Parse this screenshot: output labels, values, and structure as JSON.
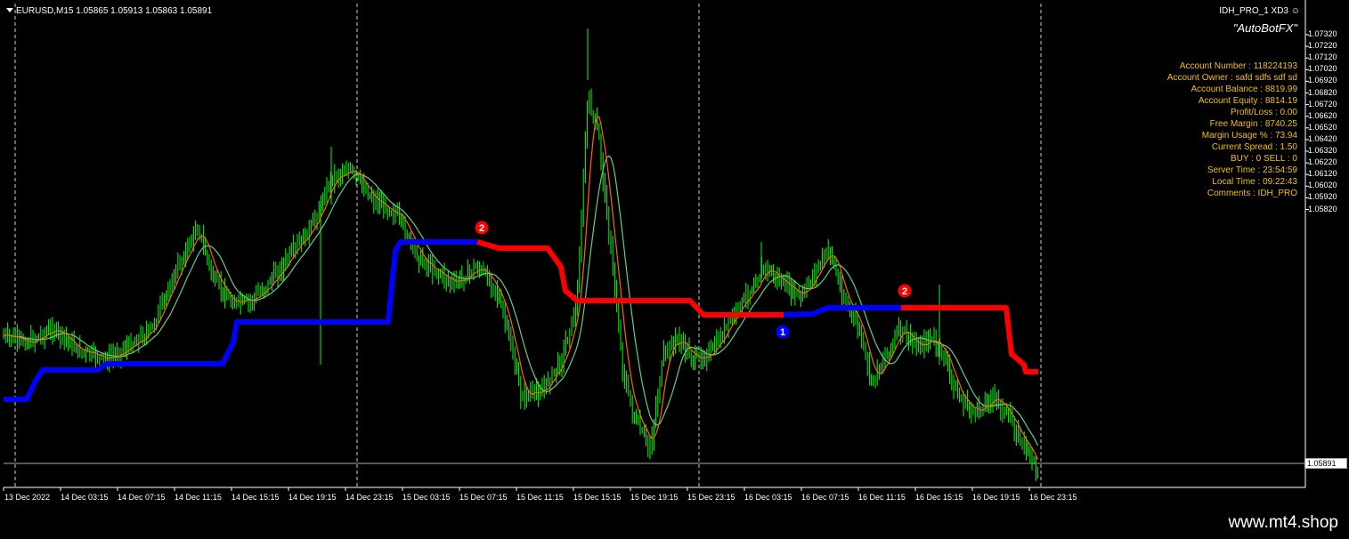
{
  "header": {
    "symbol_line": "EURUSD,M15  1.05865 1.05913 1.05863 1.05891"
  },
  "indicator": {
    "name": "IDH_PRO_1 XD3",
    "brand": "\"AutoBotFX\""
  },
  "info_panel": [
    "Account Number : 118224193",
    "Account Owner : safd    sdfs sdf  sd",
    "Account Balance : 8819.99",
    "Account Equity : 8814.19",
    "Profit/Loss : 0.00",
    "Free Margin : 8740.25",
    "Margin Usage % : 73.94",
    "Current Spread : 1.50",
    "BUY : 0 SELL : 0",
    "Server Time : 23:54:59",
    "Local Time : 09:22:43",
    "Comments : IDH_PRO"
  ],
  "price_axis": [
    "1.07320",
    "1.07220",
    "1.07120",
    "1.07020",
    "1.06920",
    "1.06820",
    "1.06720",
    "1.06620",
    "1.06520",
    "1.06420",
    "1.06320",
    "1.06220",
    "1.06120",
    "1.06020",
    "1.05920",
    "1.05820"
  ],
  "current_price": "1.05891",
  "time_axis": [
    "13 Dec 2022",
    "14 Dec 03:15",
    "14 Dec 07:15",
    "14 Dec 11:15",
    "14 Dec 15:15",
    "14 Dec 19:15",
    "14 Dec 23:15",
    "15 Dec 03:15",
    "15 Dec 07:15",
    "15 Dec 11:15",
    "15 Dec 15:15",
    "15 Dec 19:15",
    "15 Dec 23:15",
    "16 Dec 03:15",
    "16 Dec 07:15",
    "16 Dec 11:15",
    "16 Dec 15:15",
    "16 Dec 19:15",
    "16 Dec 23:15"
  ],
  "signals": [
    {
      "label": "2",
      "color": "#ff0000"
    },
    {
      "label": "1",
      "color": "#0000ff"
    },
    {
      "label": "2",
      "color": "#ff0000"
    }
  ],
  "colors": {
    "candles": "#00ff00",
    "buy_line": "#0000ff",
    "sell_line": "#ff0000",
    "ma_fast": "#ff6600",
    "ma_slow": "#66cc88",
    "text_info": "#f5c000"
  },
  "footer": {
    "site": "www.mt4.shop"
  }
}
